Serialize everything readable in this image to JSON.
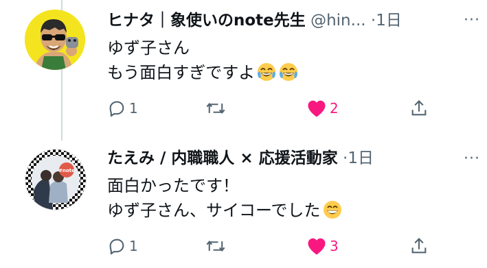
{
  "tweets": [
    {
      "display_name": "ヒナタ｜象使いのnote先生",
      "handle": "@hin...",
      "separator": "·",
      "time": "1日",
      "more": "···",
      "lines": [
        "ゆず子さん",
        "もう面白すぎですよ"
      ],
      "line_emojis": [
        [],
        [
          "laughing-crying-emoji",
          "laughing-crying-emoji"
        ]
      ],
      "reply_count": "1",
      "retweet_count": "",
      "like_count": "2",
      "liked": true,
      "colors": {
        "like": "#f91880",
        "muted": "#536471"
      }
    },
    {
      "display_name": "たえみ / 内職職人 × 応援活動家",
      "handle": "",
      "separator": "·",
      "time": "1日",
      "more": "···",
      "lines": [
        "面白かったです！",
        "ゆず子さん、サイコーでした"
      ],
      "line_emojis": [
        [],
        [
          "grinning-emoji"
        ]
      ],
      "avatar_badge": "#note",
      "reply_count": "1",
      "retweet_count": "",
      "like_count": "3",
      "liked": true,
      "colors": {
        "like": "#f91880",
        "muted": "#536471"
      }
    }
  ]
}
